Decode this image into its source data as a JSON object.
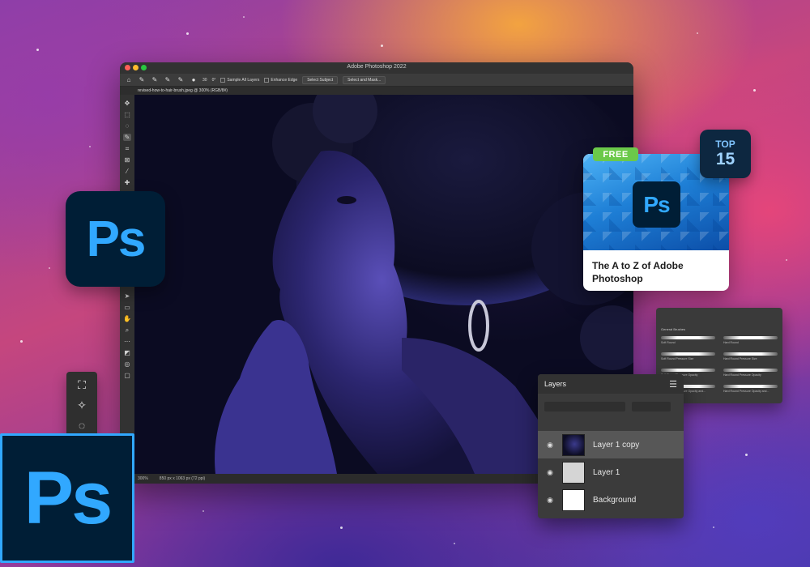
{
  "window": {
    "title": "Adobe Photoshop 2022",
    "document_tab": "revised-how-to-hair-brush.jpeg @ 300% (RGB/8#)",
    "options": {
      "brush_size": "30",
      "angle": "0°",
      "sample_all_layers": "Sample All Layers",
      "enhance_edge": "Enhance Edge",
      "select_subject": "Select Subject",
      "select_and_mask": "Select and Mask..."
    },
    "status": {
      "zoom": "300%",
      "doc_size": "850 px x 1063 px (72 ppi)"
    }
  },
  "logos": {
    "mid": "Ps",
    "big": "Ps"
  },
  "course_card": {
    "badge_free": "FREE",
    "top_badge_line1": "TOP",
    "top_badge_line2": "15",
    "logo": "Ps",
    "title_line1": "The A to Z of Adobe",
    "title_line2": "Photoshop"
  },
  "brushes_panel": {
    "group": "General Brushes",
    "items": [
      "Soft Round",
      "Hard Round",
      "Soft Round Pressure Size",
      "Hard Round Pressure Size",
      "Soft Round Pressure Opacity",
      "Hard Round Pressure Opacity",
      "Soft Round Pressure Opacity and...",
      "Hard Round Pressure Opacity and..."
    ]
  },
  "layers_panel": {
    "title": "Layers",
    "layers": [
      {
        "name": "Layer 1 copy",
        "selected": true
      },
      {
        "name": "Layer 1",
        "selected": false
      },
      {
        "name": "Background",
        "selected": false
      }
    ]
  },
  "colors": {
    "ps_blue": "#31a8ff",
    "ps_navy": "#001e36",
    "free_green": "#6bc94a"
  }
}
